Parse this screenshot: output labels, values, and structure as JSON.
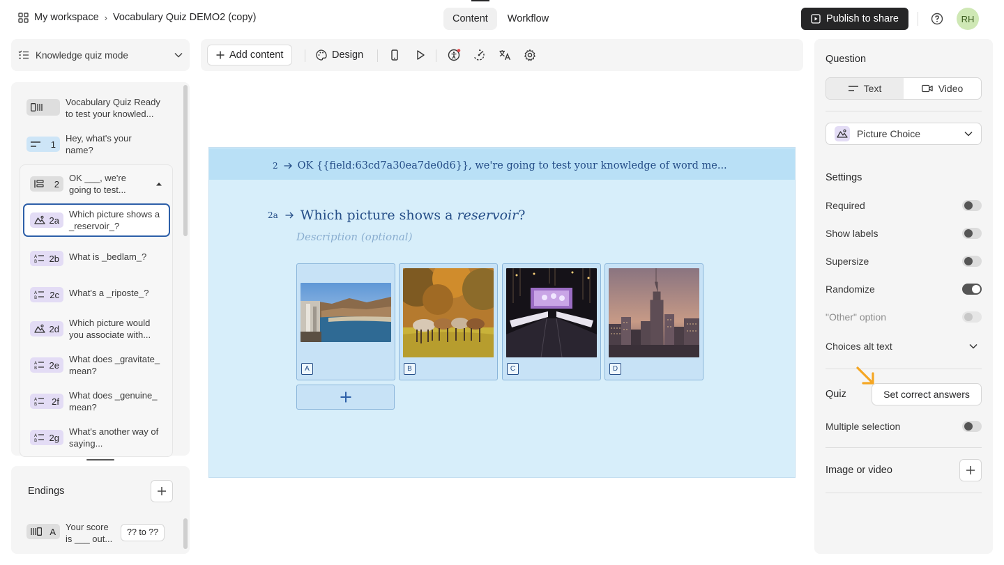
{
  "header": {
    "workspace": "My workspace",
    "form_title": "Vocabulary Quiz DEMO2 (copy)",
    "tabs": [
      {
        "label": "Content",
        "active": true
      },
      {
        "label": "Workflow",
        "active": false
      }
    ],
    "publish_label": "Publish to share",
    "avatar_initials": "RH"
  },
  "left": {
    "mode_label": "Knowledge quiz mode",
    "items": [
      {
        "badge": "",
        "type": "welcome",
        "text": "Vocabulary Quiz Ready to test your knowled..."
      },
      {
        "badge": "1",
        "type": "short-text",
        "text": "Hey, what's your name?"
      },
      {
        "badge": "2",
        "type": "group",
        "text": "OK ___, we're going to test..."
      },
      {
        "badge": "2a",
        "type": "picture-choice",
        "text": "Which picture shows a _reservoir_?"
      },
      {
        "badge": "2b",
        "type": "multiple-choice",
        "text": "What is _bedlam_?"
      },
      {
        "badge": "2c",
        "type": "multiple-choice",
        "text": "What's a _riposte_?"
      },
      {
        "badge": "2d",
        "type": "picture-choice",
        "text": "Which picture would you associate with..."
      },
      {
        "badge": "2e",
        "type": "multiple-choice",
        "text": "What does _gravitate_ mean?"
      },
      {
        "badge": "2f",
        "type": "multiple-choice",
        "text": "What does _genuine_ mean?"
      },
      {
        "badge": "2g",
        "type": "multiple-choice",
        "text": "What's another way of saying..."
      }
    ],
    "endings_title": "Endings",
    "ending": {
      "badge": "A",
      "text": "Your score is ___ out...",
      "range": "?? to ??"
    }
  },
  "toolbar": {
    "add_content": "Add content",
    "design": "Design"
  },
  "canvas": {
    "prev_number": "2",
    "prev_text": "OK {{field:63cd7a30ea7de0d6}}, we're going to test your knowledge of word me...",
    "q_number": "2a",
    "q_text_before": "Which picture shows a ",
    "q_text_em": "reservoir",
    "q_text_after": "?",
    "description_placeholder": "Description (optional)",
    "choices": [
      {
        "letter": "A",
        "image": "dam-lake-photo"
      },
      {
        "letter": "B",
        "image": "horses-photo"
      },
      {
        "letter": "C",
        "image": "restaurant-photo"
      },
      {
        "letter": "D",
        "image": "city-skyline-photo"
      }
    ]
  },
  "right": {
    "question_title": "Question",
    "seg": [
      {
        "label": "Text",
        "active": true
      },
      {
        "label": "Video",
        "active": false
      }
    ],
    "type_label": "Picture Choice",
    "settings_title": "Settings",
    "settings": [
      {
        "label": "Required",
        "on": false,
        "disabled": false
      },
      {
        "label": "Show labels",
        "on": false,
        "disabled": false
      },
      {
        "label": "Supersize",
        "on": false,
        "disabled": false
      },
      {
        "label": "Randomize",
        "on": true,
        "disabled": false
      },
      {
        "label": "\"Other\" option",
        "on": false,
        "disabled": true
      }
    ],
    "alt_text_label": "Choices alt text",
    "quiz_title": "Quiz",
    "set_correct_label": "Set correct answers",
    "multiple_selection_label": "Multiple selection",
    "image_video_title": "Image or video"
  },
  "colors": {
    "accent": "#2d5fa8",
    "canvas_bg": "#d7eefa",
    "arrow": "#f5a623"
  }
}
